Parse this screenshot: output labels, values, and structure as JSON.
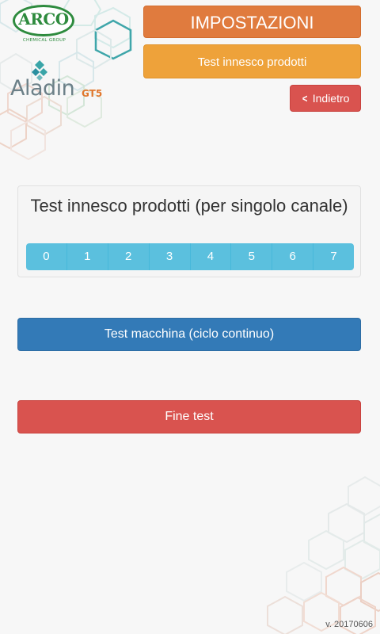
{
  "brand": {
    "arco_name": "ARCO",
    "arco_subtitle": "CHEMICAL GROUP",
    "product_name": "Aladin",
    "product_model": "GT5"
  },
  "header": {
    "title": "IMPOSTAZIONI",
    "section": "Test innesco prodotti",
    "back_label": "Indietro"
  },
  "panel": {
    "title": "Test innesco prodotti (per singolo canale)",
    "channels": [
      "0",
      "1",
      "2",
      "3",
      "4",
      "5",
      "6",
      "7"
    ]
  },
  "actions": {
    "machine_test": "Test macchina (ciclo continuo)",
    "end_test": "Fine test"
  },
  "footer": {
    "version": "v. 20170606"
  },
  "colors": {
    "title_orange": "#e07b3e",
    "section_amber": "#eea23a",
    "danger_red": "#d9534f",
    "info_cyan": "#5bc0de",
    "primary_blue": "#337ab7"
  }
}
